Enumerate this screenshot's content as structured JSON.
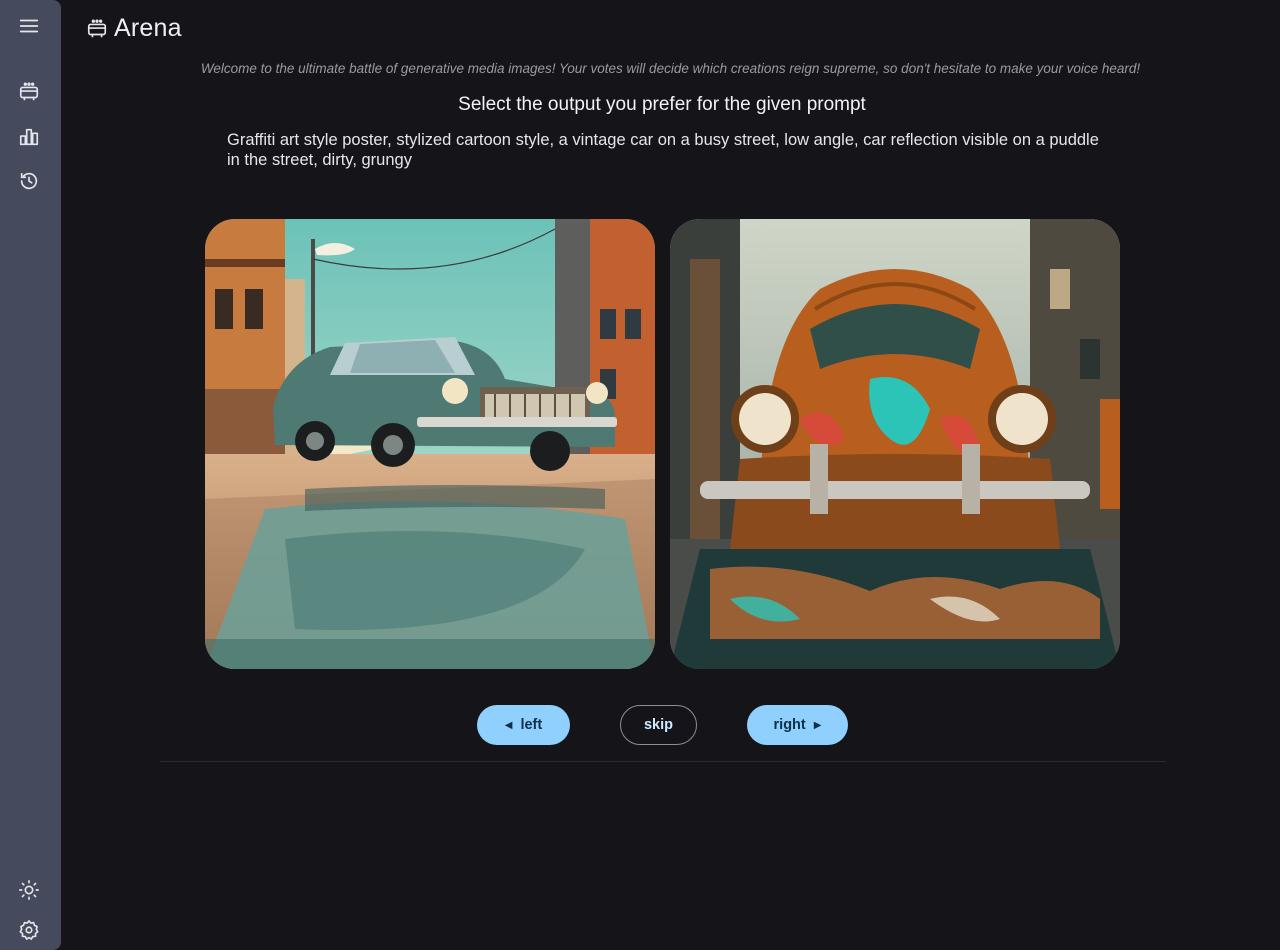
{
  "sidebar": {
    "items": [
      {
        "icon": "menu-icon"
      },
      {
        "icon": "arena-icon"
      },
      {
        "icon": "leaderboard-icon"
      },
      {
        "icon": "history-icon"
      }
    ],
    "bottom": [
      {
        "icon": "theme-toggle-icon"
      },
      {
        "icon": "settings-icon"
      }
    ]
  },
  "header": {
    "title": "Arena",
    "logo_icon": "arena-icon"
  },
  "main": {
    "welcome": "Welcome to the ultimate battle of generative media images! Your votes will decide which creations reign supreme, so don't hesitate to make your voice heard!",
    "heading": "Select the output you prefer for the given prompt",
    "prompt": "Graffiti art style poster, stylized cartoon style, a vintage car on a busy street, low angle, car reflection visible on a puddle in the street, dirty, grungy"
  },
  "buttons": {
    "left": "left",
    "skip": "skip",
    "right": "right"
  },
  "colors": {
    "accent": "#8fd0ff",
    "sidebar": "#454a5c",
    "background": "#141419"
  }
}
